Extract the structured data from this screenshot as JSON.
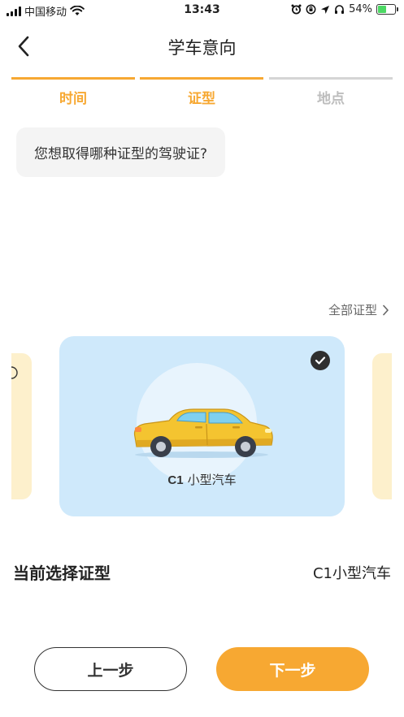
{
  "status_bar": {
    "carrier": "中国移动",
    "time": "13:43",
    "battery_percent": "54%",
    "battery_level": 0.54,
    "icons": [
      "signal-icon",
      "wifi-icon",
      "alarm-icon",
      "orientation-lock-icon",
      "location-icon",
      "headphones-icon",
      "battery-icon"
    ]
  },
  "nav": {
    "title": "学车意向",
    "back_icon": "chevron-left-icon"
  },
  "steps": [
    {
      "label": "时间",
      "state": "done"
    },
    {
      "label": "证型",
      "state": "active"
    },
    {
      "label": "地点",
      "state": "pending"
    }
  ],
  "colors": {
    "accent": "#f7a832",
    "inactive": "#bdbdbd",
    "card_bg": "#cfe9fb",
    "side_card_bg": "#fdf0cc"
  },
  "question": "您想取得哪种证型的驾驶证?",
  "all_types_link": "全部证型",
  "license_card": {
    "code": "C1",
    "name": "小型汽车",
    "selected": true,
    "icon": "car-icon"
  },
  "current_selection": {
    "label": "当前选择证型",
    "value": "C1小型汽车"
  },
  "buttons": {
    "prev": "上一步",
    "next": "下一步"
  }
}
